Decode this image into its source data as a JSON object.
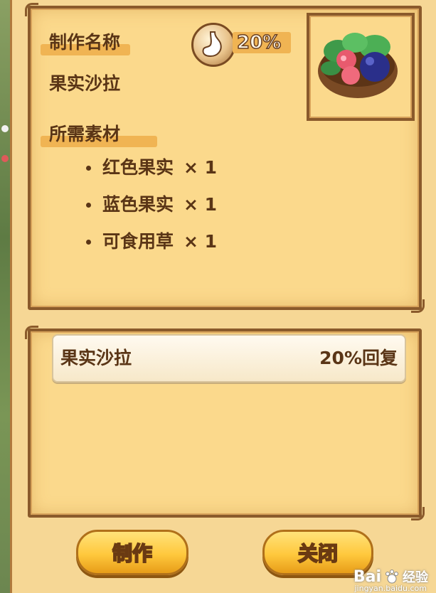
{
  "recipe": {
    "name_heading": "制作名称",
    "name": "果实沙拉",
    "recovery_percent": "20%",
    "materials_heading": "所需素材",
    "materials": [
      {
        "name": "红色果实",
        "qty": "× 1"
      },
      {
        "name": "蓝色果实",
        "qty": "× 1"
      },
      {
        "name": "可食用草",
        "qty": "× 1"
      }
    ]
  },
  "recipe_list": [
    {
      "name": "果实沙拉",
      "effect": "20%回复"
    }
  ],
  "buttons": {
    "craft": "制作",
    "close": "关闭"
  },
  "icons": {
    "stomach": "stomach-icon",
    "item": "fruit-salad-bowl-icon"
  },
  "watermark": {
    "brand": "Bai",
    "brand2": "经验",
    "url": "jingyan.baidu.com"
  },
  "colors": {
    "panel": "#fbd98c",
    "border": "#8a5a2b",
    "text": "#5a3516",
    "button": "#ffc83d"
  }
}
